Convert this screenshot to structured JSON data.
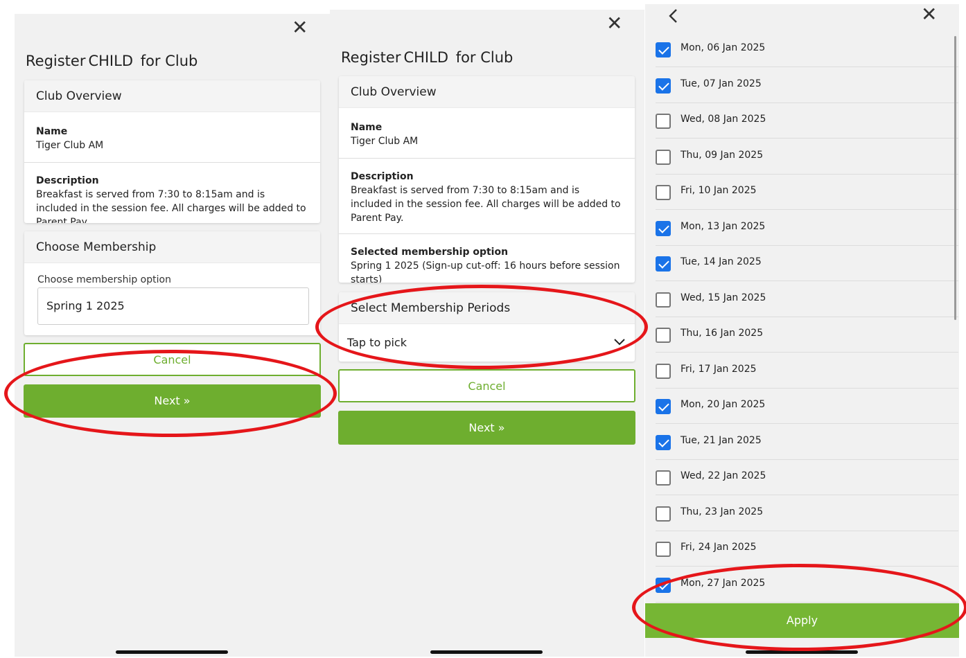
{
  "form": {
    "title_prefix": "Register",
    "title_child": "CHILD",
    "title_suffix": "for Club",
    "overview_header": "Club Overview",
    "name_label": "Name",
    "name_value": "Tiger Club AM",
    "description_label": "Description",
    "description_value": "Breakfast is served from 7:30 to 8:15am and is included in the session fee. All charges will be added to Parent Pay.",
    "cancel_label": "Cancel",
    "next_label": "Next »"
  },
  "screen1": {
    "membership_header": "Choose Membership",
    "membership_field_label": "Choose membership option",
    "membership_value": "Spring 1 2025"
  },
  "screen2": {
    "selected_label": "Selected membership option",
    "selected_value": "Spring 1 2025 (Sign-up cut-off: 16 hours before session starts)",
    "periods_header": "Select Membership Periods",
    "periods_placeholder": "Tap to pick"
  },
  "screen3": {
    "apply_label": "Apply",
    "dates": [
      {
        "label": "Mon, 06 Jan 2025",
        "checked": true
      },
      {
        "label": "Tue, 07 Jan 2025",
        "checked": true
      },
      {
        "label": "Wed, 08 Jan 2025",
        "checked": false
      },
      {
        "label": "Thu, 09 Jan 2025",
        "checked": false
      },
      {
        "label": "Fri, 10 Jan 2025",
        "checked": false
      },
      {
        "label": "Mon, 13 Jan 2025",
        "checked": true
      },
      {
        "label": "Tue, 14 Jan 2025",
        "checked": true
      },
      {
        "label": "Wed, 15 Jan 2025",
        "checked": false
      },
      {
        "label": "Thu, 16 Jan 2025",
        "checked": false
      },
      {
        "label": "Fri, 17 Jan 2025",
        "checked": false
      },
      {
        "label": "Mon, 20 Jan 2025",
        "checked": true
      },
      {
        "label": "Tue, 21 Jan 2025",
        "checked": true
      },
      {
        "label": "Wed, 22 Jan 2025",
        "checked": false
      },
      {
        "label": "Thu, 23 Jan 2025",
        "checked": false
      },
      {
        "label": "Fri, 24 Jan 2025",
        "checked": false
      },
      {
        "label": "Mon, 27 Jan 2025",
        "checked": true
      }
    ]
  },
  "colors": {
    "accent_green": "#6eae2f",
    "checkbox_blue": "#1a73e8",
    "annotation_red": "#e5161a"
  },
  "icons": {
    "close": "close-icon",
    "back": "chevron-left-icon",
    "dropdown": "chevron-down-icon"
  }
}
